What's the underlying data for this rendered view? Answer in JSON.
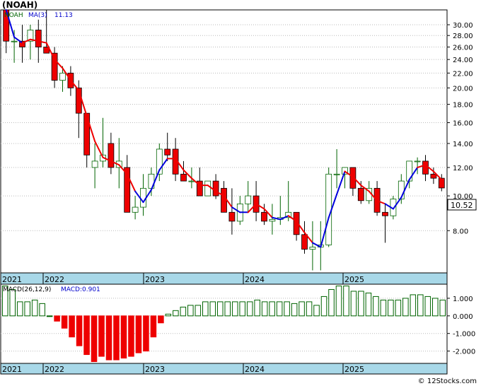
{
  "ticker": "(NOAH)",
  "credit": "© 12Stocks.com",
  "colors": {
    "up": "#006400",
    "down": "#ee0000",
    "ma_down": "#ee0000",
    "ma_up": "#0000dd",
    "axis_band": "#a8d8e8",
    "grid": "#bbbbbb",
    "macd_pos": "#006400",
    "macd_neg": "#ee0000"
  },
  "chart_data": [
    {
      "type": "candlestick",
      "title": "",
      "legend": {
        "symbol": "NOAH",
        "ma_label": "MA(3)",
        "ma_value": "11.13"
      },
      "last_price_label": "10.52",
      "y_scale": "log",
      "ylim": [
        6.1,
        33
      ],
      "y_ticks": [
        "8.00",
        "10.00",
        "12.00",
        "14.00",
        "16.00",
        "18.00",
        "20.00",
        "22.00",
        "24.00",
        "26.00",
        "28.00",
        "30.00"
      ],
      "x_labels": [
        "2021",
        "2022",
        "2023",
        "2024",
        "2025"
      ],
      "candles": [
        [
          33,
          33,
          25,
          27
        ],
        [
          27,
          29,
          23.5,
          27
        ],
        [
          27,
          30,
          23.5,
          26
        ],
        [
          27,
          30,
          24,
          29
        ],
        [
          29,
          31,
          23.5,
          26
        ],
        [
          26,
          33,
          25,
          25
        ],
        [
          25,
          26,
          20,
          21
        ],
        [
          21,
          23,
          19.5,
          22
        ],
        [
          22,
          23,
          19,
          20
        ],
        [
          20,
          21,
          14.5,
          17
        ],
        [
          17,
          17,
          12,
          13
        ],
        [
          12,
          14,
          10.5,
          12.5
        ],
        [
          12.5,
          16.5,
          12,
          13
        ],
        [
          14,
          15,
          11.5,
          12
        ],
        [
          12,
          14.5,
          10.5,
          12.5
        ],
        [
          12,
          13,
          9,
          9
        ],
        [
          9,
          10,
          8.6,
          9.3
        ],
        [
          9.3,
          11.5,
          8.8,
          10.5
        ],
        [
          10.5,
          12,
          10,
          11.5
        ],
        [
          11.5,
          14,
          11,
          13.5
        ],
        [
          13.5,
          15,
          12.5,
          13
        ],
        [
          13.5,
          14.5,
          11,
          11.5
        ],
        [
          11.5,
          12.5,
          11,
          11
        ],
        [
          11,
          12,
          10.5,
          11
        ],
        [
          11,
          12,
          10,
          10
        ],
        [
          10,
          11,
          10,
          11
        ],
        [
          11,
          11.5,
          9.8,
          10
        ],
        [
          10.5,
          11,
          9,
          9
        ],
        [
          9,
          10.5,
          7.8,
          8.5
        ],
        [
          8.5,
          10,
          8.3,
          9.5
        ],
        [
          9.5,
          11,
          9,
          10
        ],
        [
          10,
          11,
          8.5,
          9
        ],
        [
          9,
          9.5,
          8.3,
          8.5
        ],
        [
          8.5,
          9.5,
          7.8,
          8.6
        ],
        [
          8.6,
          10,
          8.3,
          8.7
        ],
        [
          8.7,
          11,
          8.5,
          9
        ],
        [
          9,
          9,
          7.5,
          7.8
        ],
        [
          7.8,
          8.5,
          6.9,
          7.1
        ],
        [
          7.1,
          8.5,
          6.2,
          7.2
        ],
        [
          7.2,
          8.5,
          6.2,
          7.3
        ],
        [
          7.3,
          12,
          7.2,
          11.5
        ],
        [
          11.5,
          13.5,
          10.5,
          11.5
        ],
        [
          11.5,
          12,
          10.5,
          12
        ],
        [
          12,
          12,
          10,
          10.5
        ],
        [
          10.5,
          11,
          9.5,
          9.7
        ],
        [
          9.7,
          11,
          9.5,
          10.5
        ],
        [
          10.5,
          11,
          8.8,
          9
        ],
        [
          9,
          9.5,
          7.4,
          8.8
        ],
        [
          8.8,
          10,
          8.6,
          9.8
        ],
        [
          9.8,
          11.5,
          9.5,
          11
        ],
        [
          11,
          12.5,
          10.5,
          12.5
        ],
        [
          12.5,
          12.8,
          11.5,
          12.5
        ],
        [
          12.5,
          13,
          11,
          11.5
        ],
        [
          11.5,
          12,
          10.8,
          11.2
        ],
        [
          11.2,
          11.5,
          10.3,
          10.52
        ]
      ],
      "ma3": [
        33,
        27.7,
        26.7,
        27.3,
        27,
        26.7,
        24,
        22.7,
        21,
        19.7,
        16.7,
        14.2,
        12.8,
        12.5,
        12.2,
        11.5,
        10.3,
        9.6,
        10.4,
        11.8,
        12.7,
        12.7,
        11.8,
        11.2,
        10.7,
        10.7,
        10.3,
        10,
        9.3,
        9,
        9,
        9.5,
        9.2,
        8.7,
        8.6,
        8.8,
        8.5,
        7.9,
        7.4,
        7.2,
        8.7,
        10.1,
        11.7,
        11.3,
        10.7,
        10.3,
        9.7,
        9.5,
        9.2,
        9.9,
        11.1,
        12,
        12.2,
        11.7,
        11.1
      ],
      "ma_colors": [
        "down",
        "up",
        "up",
        "down",
        "down",
        "down",
        "down",
        "down",
        "down",
        "down",
        "down",
        "down",
        "down",
        "down",
        "down",
        "down",
        "down",
        "up",
        "up",
        "up",
        "up",
        "down",
        "down",
        "down",
        "down",
        "down",
        "down",
        "down",
        "down",
        "up",
        "up",
        "down",
        "down",
        "down",
        "up",
        "up",
        "down",
        "down",
        "down",
        "up",
        "up",
        "up",
        "up",
        "down",
        "down",
        "down",
        "down",
        "down",
        "up",
        "up",
        "up",
        "up",
        "down",
        "down",
        "down"
      ]
    },
    {
      "type": "bar",
      "title": "",
      "legend": {
        "label": "MACD(26,12,9)",
        "value_label": "MACD:0.901"
      },
      "ylim": [
        -2.7,
        1.8
      ],
      "y_ticks": [
        "1.000",
        "0.000",
        "-1.000",
        "-2.000"
      ],
      "x_labels": [
        "2021",
        "2022",
        "2023",
        "2024",
        "2025"
      ],
      "values": [
        1.7,
        1.5,
        0.8,
        0.8,
        0.9,
        0.7,
        0.0,
        -0.3,
        -0.7,
        -1.2,
        -1.7,
        -2.2,
        -2.6,
        -2.3,
        -2.5,
        -2.5,
        -2.4,
        -2.3,
        -2.1,
        -2.0,
        -1.2,
        -0.4,
        0.1,
        0.3,
        0.5,
        0.6,
        0.6,
        0.8,
        0.8,
        0.8,
        0.8,
        0.8,
        0.8,
        0.8,
        0.9,
        0.8,
        0.8,
        0.8,
        0.8,
        0.7,
        0.8,
        0.8,
        0.6,
        1.1,
        1.5,
        1.7,
        1.7,
        1.4,
        1.4,
        1.3,
        1.1,
        0.9,
        0.9,
        0.9,
        1.0,
        1.2,
        1.2,
        1.1,
        1.0,
        0.9
      ]
    }
  ]
}
